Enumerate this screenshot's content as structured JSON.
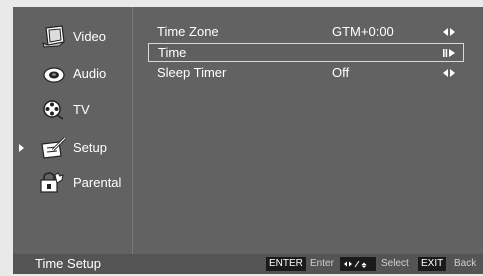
{
  "sidebar": {
    "items": [
      {
        "label": "Video",
        "icon": "monitor-icon"
      },
      {
        "label": "Audio",
        "icon": "speaker-icon"
      },
      {
        "label": "TV",
        "icon": "film-reel-icon"
      },
      {
        "label": "Setup",
        "icon": "setup-icon",
        "active": true
      },
      {
        "label": "Parental",
        "icon": "parental-lock-icon"
      }
    ]
  },
  "settings": {
    "rows": [
      {
        "name": "Time Zone",
        "value": "GTM+0:00",
        "control": "left-right-arrows-icon"
      },
      {
        "name": "Time",
        "value": "",
        "control": "enter-arrow-icon",
        "selected": true
      },
      {
        "name": "Sleep Timer",
        "value": "Off",
        "control": "left-right-arrows-icon"
      }
    ]
  },
  "footer": {
    "title": "Time Setup",
    "enter_key": "ENTER",
    "enter_text": "Enter",
    "select_text": "Select",
    "exit_key": "EXIT",
    "back_text": "Back"
  },
  "colors": {
    "background": "#626262",
    "footer": "#545454",
    "text": "#ffffff",
    "key_background": "#1a1a1a"
  }
}
